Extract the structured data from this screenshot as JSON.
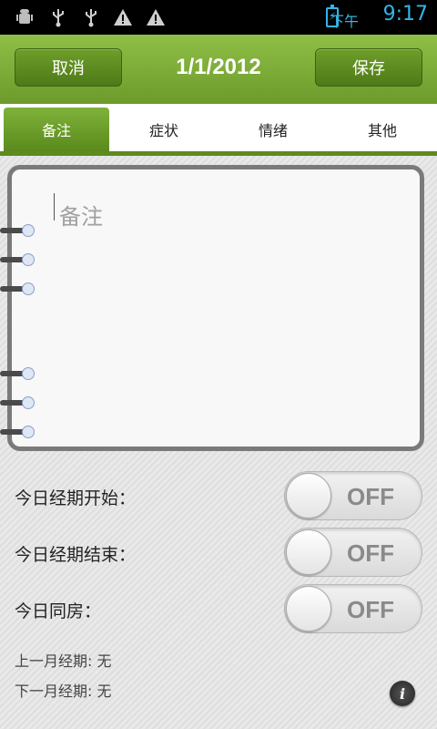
{
  "status_bar": {
    "icons": [
      "android-debug-icon",
      "usb-icon",
      "usb-icon",
      "warning-icon",
      "warning-icon"
    ],
    "ampm": "下午",
    "time": "9:17"
  },
  "header": {
    "cancel_label": "取消",
    "date": "1/1/2012",
    "save_label": "保存"
  },
  "tabs": [
    {
      "label": "备注",
      "active": true
    },
    {
      "label": "症状",
      "active": false
    },
    {
      "label": "情绪",
      "active": false
    },
    {
      "label": "其他",
      "active": false
    }
  ],
  "note": {
    "placeholder": "备注"
  },
  "toggles": [
    {
      "label": "今日经期开始：",
      "state": "OFF"
    },
    {
      "label": "今日经期结束：",
      "state": "OFF"
    },
    {
      "label": "今日同房：",
      "state": "OFF"
    }
  ],
  "info": {
    "last_period": "上一月经期: 无",
    "next_period": "下一月经期: 无"
  }
}
